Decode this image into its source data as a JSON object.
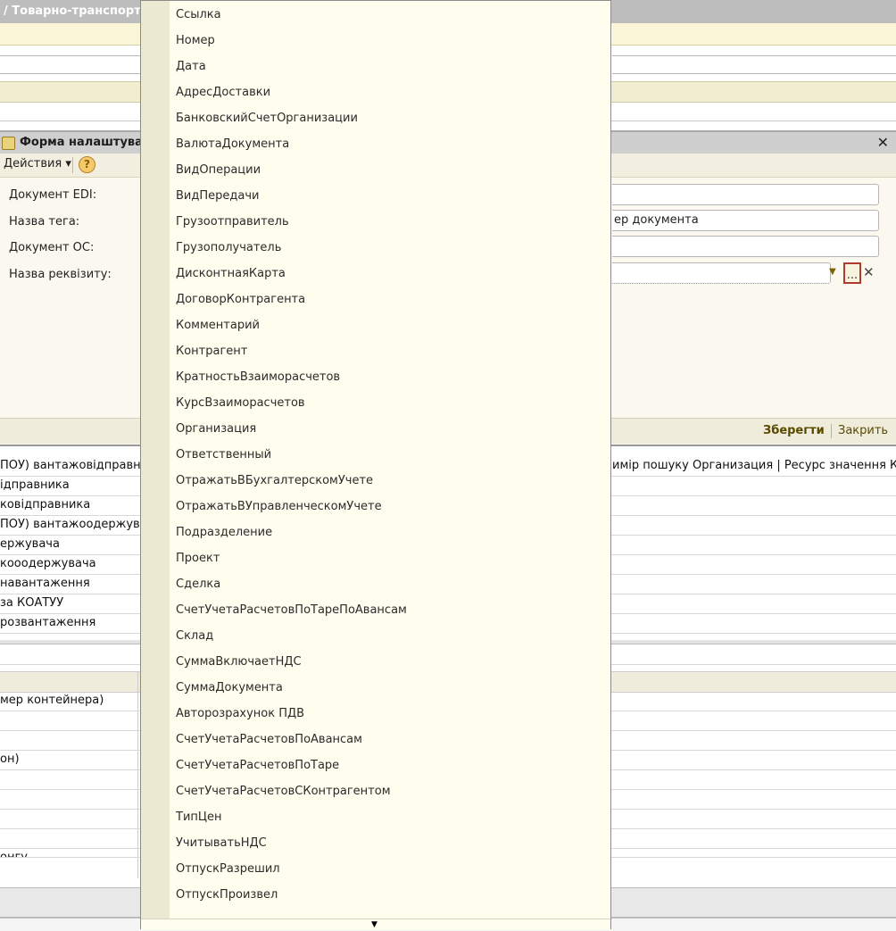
{
  "window": {
    "title": "/ Товарно-транспорт"
  },
  "dialog": {
    "title": "Форма налаштува",
    "actions_label": "Действия ▾",
    "help": "?",
    "labels": {
      "edi_document": "Документ EDI:",
      "tag_name": "Назва тега:",
      "os_document": "Документ ОС:",
      "attribute_name": "Назва реквізиту:"
    },
    "fields": {
      "edi_document": "",
      "tag_name": "ер документа",
      "os_document": "",
      "attribute_name": ""
    },
    "ellipsis": "...",
    "clear": "✕",
    "close": "✕",
    "save": "Зберегти",
    "close_button": "Закрить"
  },
  "table_rows": [
    {
      "left": "ПОУ) вантажовідправни",
      "right": "имір пошуку Организация | Ресурс значення КодП"
    },
    {
      "left": "ідправника",
      "right": ""
    },
    {
      "left": "ковідправника",
      "right": ""
    },
    {
      "left": "ПОУ) вантажоодержува",
      "right": ""
    },
    {
      "left": "ержувача",
      "right": ""
    },
    {
      "left": "кооодержувача",
      "right": ""
    },
    {
      "left": "навантаження",
      "right": ""
    },
    {
      "left": "за КОАТУУ",
      "right": ""
    },
    {
      "left": "розвантаження",
      "right": ""
    }
  ],
  "table2_rows": [
    "мер контейнера)",
    "",
    "",
    "он)",
    "",
    "",
    "",
    "",
    "онгу"
  ],
  "dropdown": {
    "items": [
      "Ссылка",
      "Номер",
      "Дата",
      "АдресДоставки",
      "БанковскийСчетОрганизации",
      "ВалютаДокумента",
      "ВидОперации",
      "ВидПередачи",
      "Грузоотправитель",
      "Грузополучатель",
      "ДисконтнаяКарта",
      "ДоговорКонтрагента",
      "Комментарий",
      "Контрагент",
      "КратностьВзаиморасчетов",
      "КурсВзаиморасчетов",
      "Организация",
      "Ответственный",
      "ОтражатьВБухгалтерскомУчете",
      "ОтражатьВУправленческомУчете",
      "Подразделение",
      "Проект",
      "Сделка",
      "СчетУчетаРасчетовПоТареПоАвансам",
      "Склад",
      "СуммаВключаетНДС",
      "СуммаДокумента",
      "Авторозрахунок ПДВ",
      "СчетУчетаРасчетовПоАвансам",
      "СчетУчетаРасчетовПоТаре",
      "СчетУчетаРасчетовСКонтрагентом",
      "ТипЦен",
      "УчитыватьНДС",
      "ОтпускРазрешил",
      "ОтпускПроизвел"
    ],
    "scroll_arrow": "▼"
  }
}
